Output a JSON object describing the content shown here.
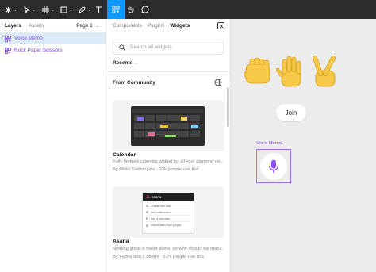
{
  "toolbar": {
    "colors": {
      "bg": "#2c2c2c",
      "active": "#0d99ff"
    },
    "tools": [
      {
        "name": "figma-menu",
        "icon": "figma-logo-icon"
      },
      {
        "name": "move-tool",
        "icon": "cursor-icon"
      },
      {
        "name": "frame-tool",
        "icon": "frame-icon"
      },
      {
        "name": "shape-tool",
        "icon": "rectangle-icon"
      },
      {
        "name": "pen-tool",
        "icon": "pen-icon"
      },
      {
        "name": "text-tool",
        "icon": "text-icon"
      },
      {
        "name": "resources-tool",
        "icon": "resources-icon",
        "active": true
      },
      {
        "name": "hand-tool",
        "icon": "hand-icon"
      },
      {
        "name": "comment-tool",
        "icon": "comment-icon"
      }
    ]
  },
  "layers": {
    "tabs": {
      "layers": "Layers",
      "assets": "Assets"
    },
    "page": "Page 1",
    "items": [
      {
        "label": "Voice Memo",
        "selected": true
      },
      {
        "label": "Rock Paper Scissors",
        "selected": false
      }
    ]
  },
  "widgets": {
    "tabs": {
      "components": "Components",
      "plugins": "Plugins",
      "widgets": "Widgets"
    },
    "search_placeholder": "Search all widgets",
    "recents_label": "Recents",
    "community_label": "From Community",
    "cards": [
      {
        "title": "Calendar",
        "description": "Fully fledged calendar widget for all your planning ne...",
        "meta": "By Mirko Santangelo · 22k people use this"
      },
      {
        "title": "Asana",
        "description": "Nothing great is made alone, so why should we mana...",
        "meta": "By Figma and 2 others · 6.7k people use this",
        "preview": {
          "brand": "asana",
          "items": [
            "Create new task",
            "Set collaborators",
            "Add a new task",
            "Import tasks from project"
          ]
        }
      }
    ]
  },
  "canvas": {
    "join_label": "Join",
    "voice_memo_label": "Voice Memo",
    "colors": {
      "accent": "#7a3df0",
      "hand": "#f7c948"
    }
  }
}
